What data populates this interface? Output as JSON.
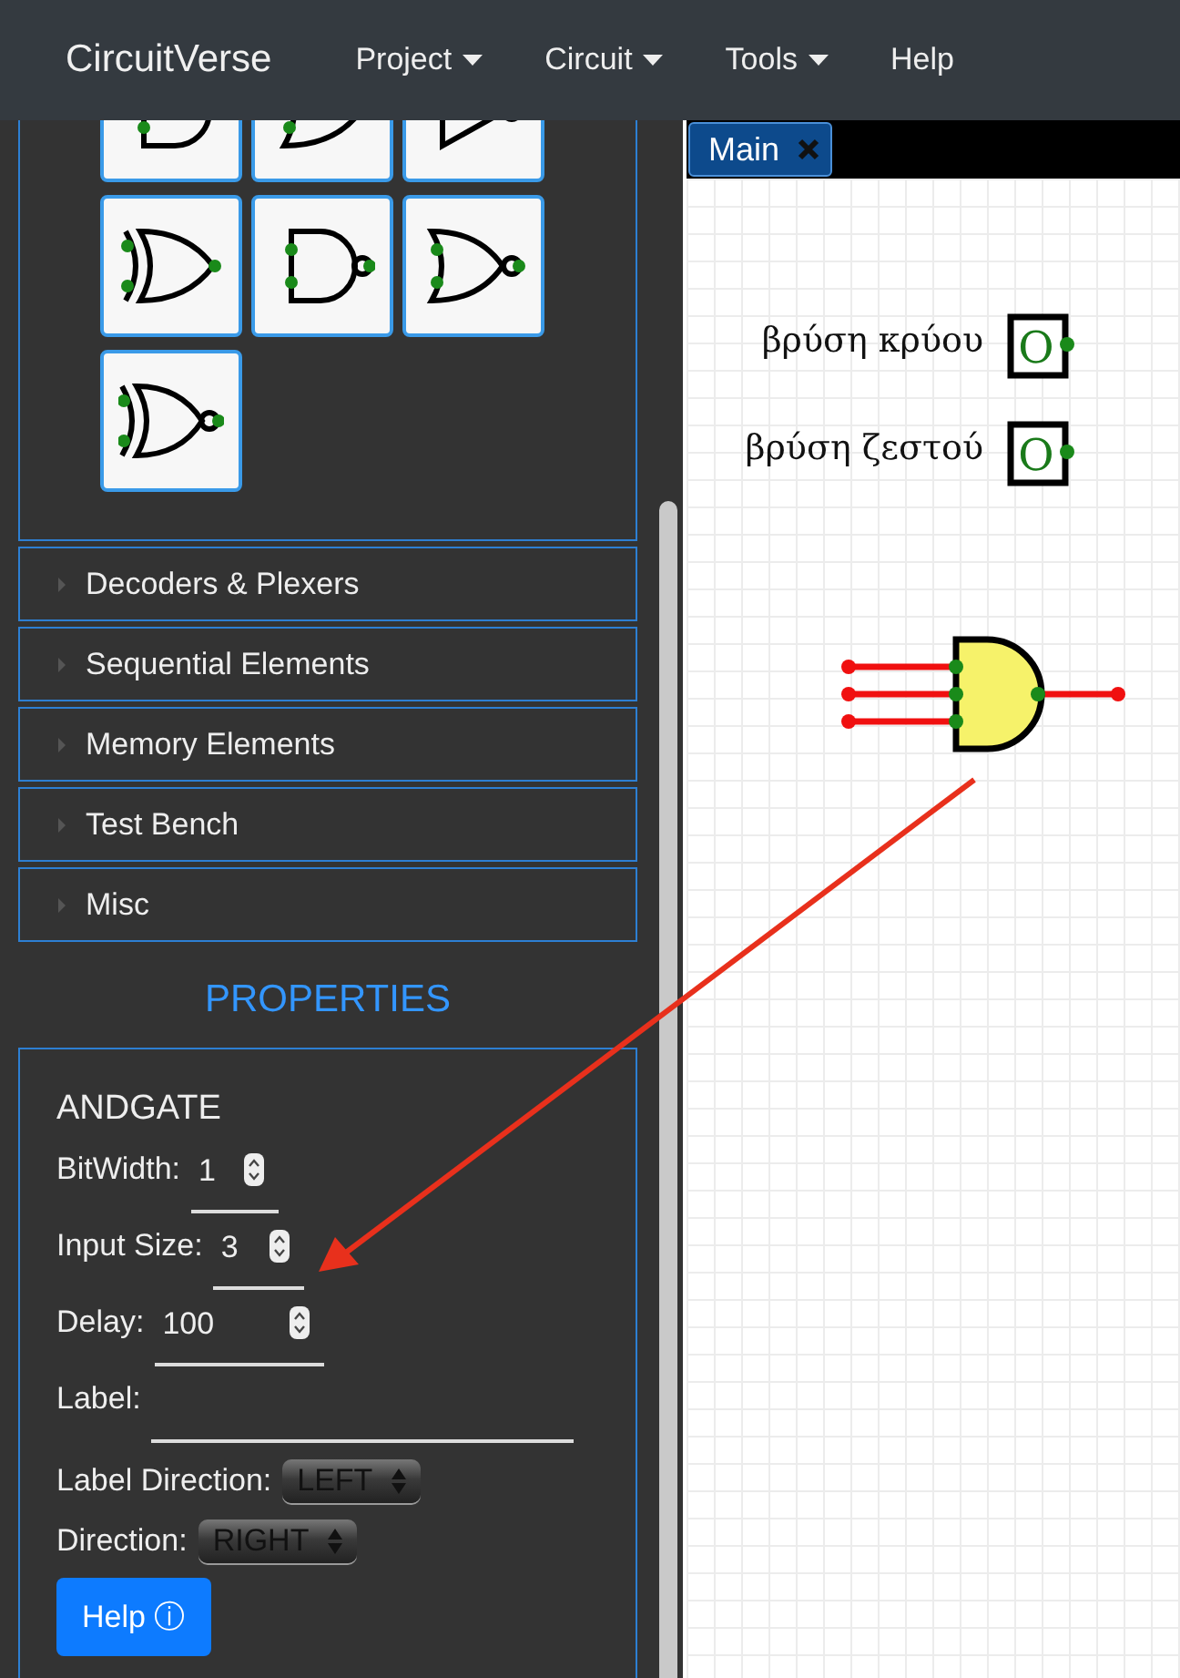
{
  "navbar": {
    "brand": "CircuitVerse",
    "menus": [
      {
        "label": "Project",
        "dropdown": true
      },
      {
        "label": "Circuit",
        "dropdown": true
      },
      {
        "label": "Tools",
        "dropdown": true
      },
      {
        "label": "Help",
        "dropdown": false
      }
    ]
  },
  "gate_palette": [
    {
      "kind": "and"
    },
    {
      "kind": "or"
    },
    {
      "kind": "not"
    },
    {
      "kind": "xor"
    },
    {
      "kind": "nand"
    },
    {
      "kind": "nor"
    },
    {
      "kind": "xnor"
    }
  ],
  "categories": [
    {
      "label": "Decoders & Plexers",
      "expanded": false
    },
    {
      "label": "Sequential Elements",
      "expanded": false
    },
    {
      "label": "Memory Elements",
      "expanded": false
    },
    {
      "label": "Test Bench",
      "expanded": false
    },
    {
      "label": "Misc",
      "expanded": false
    }
  ],
  "properties": {
    "heading": "PROPERTIES",
    "title": "ANDGATE",
    "fields": [
      {
        "kind": "number",
        "label": "BitWidth:",
        "value": "1"
      },
      {
        "kind": "number",
        "label": "Input Size:",
        "value": "3"
      },
      {
        "kind": "number",
        "label": "Delay:",
        "value": "100"
      },
      {
        "kind": "text",
        "label": "Label:"
      },
      {
        "kind": "select",
        "label": "Label Direction:",
        "value": "LEFT"
      },
      {
        "kind": "select",
        "label": "Direction:",
        "value": "RIGHT"
      }
    ],
    "help_button": "Help ⓘ"
  },
  "tabs": [
    {
      "label": "Main",
      "selected": true
    }
  ],
  "canvas": {
    "elements": [
      {
        "kind": "output",
        "label": "βρύση κρύου",
        "symbol": "O"
      },
      {
        "kind": "output",
        "label": "βρύση ζεστού",
        "symbol": "O"
      },
      {
        "kind": "and_gate"
      }
    ]
  }
}
